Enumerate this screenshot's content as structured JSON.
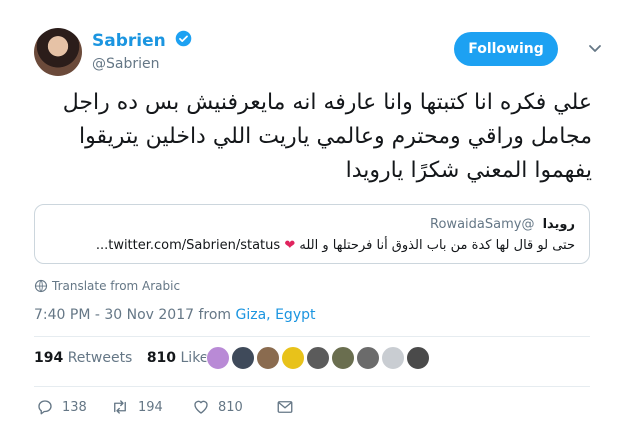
{
  "user": {
    "display_name": "Sabrien",
    "handle": "@Sabrien",
    "verified": true
  },
  "follow_label": "Following",
  "tweet_lines": [
    "علي فكره انا كتبتها وانا عارفه انه مايعرفنيش بس ده راجل",
    "مجامل وراقي ومحترم وعالمي ياريت اللي داخلين يتريقوا",
    "يفهموا المعني  شكرًا يارويدا"
  ],
  "quote": {
    "name": "رويدا",
    "handle": "@RowaidaSamy",
    "body_text": "حتى لو قال لها كدة من باب الذوق أنا فرحتلها و الله",
    "link": "twitter.com/Sabrien/status..."
  },
  "translate_label": "Translate from Arabic",
  "timestamp": {
    "time_date": "7:40 PM - 30 Nov 2017 from",
    "location": "Giza, Egypt"
  },
  "stats": {
    "retweets": "194",
    "retweets_label": "Retweets",
    "likes": "810",
    "likes_label": "Likes"
  },
  "liker_colors": [
    "#b98ad6",
    "#3f4a5a",
    "#8a6b4f",
    "#e8c21a",
    "#5b5b5b",
    "#6a6e4f",
    "#6b6b6b",
    "#c9cdd2",
    "#4a4a4a"
  ],
  "actions": {
    "reply_count": "138",
    "retweet_count": "194",
    "like_count": "810"
  },
  "colors": {
    "accent": "#1da1f2",
    "link": "#1b95e0",
    "muted": "#657786",
    "like": "#e0245e"
  }
}
